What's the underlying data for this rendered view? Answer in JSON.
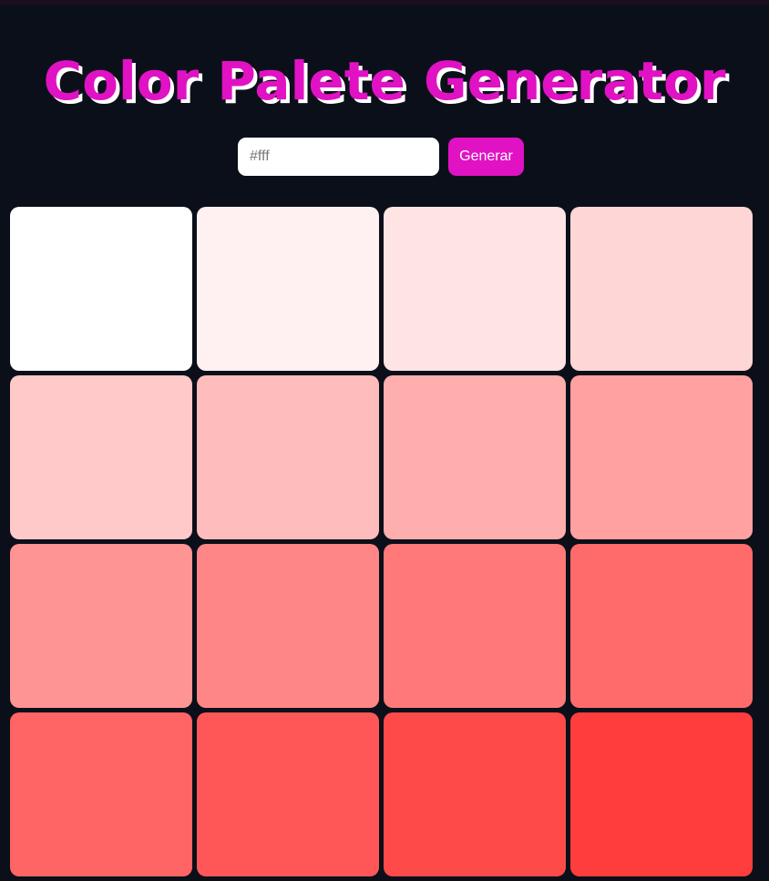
{
  "app": {
    "title": "Color Palete Generator"
  },
  "controls": {
    "input_placeholder": "#fff",
    "input_value": "",
    "generate_label": "Generar"
  },
  "colors": {
    "background": "#0b0f19",
    "accent": "#e012c4",
    "title_shadow": "#ffffff"
  },
  "palette": {
    "swatches": [
      "#ffffff",
      "#fff1f1",
      "#ffe4e4",
      "#ffd6d6",
      "#ffc9c9",
      "#ffbcbc",
      "#ffaeae",
      "#ffa1a1",
      "#ff9494",
      "#ff8686",
      "#ff7979",
      "#ff6b6b",
      "#ff6565",
      "#ff5757",
      "#ff4a4a",
      "#ff3d3d"
    ]
  }
}
